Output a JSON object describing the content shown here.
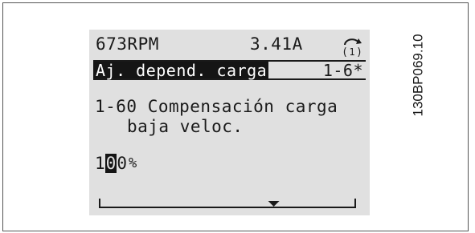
{
  "status": {
    "speed": "673RPM",
    "current": "3.41A",
    "active_setup_icon": "setup-1-icon",
    "active_setup": "1"
  },
  "menu": {
    "title": "Aj. depend. carga",
    "index": "1-6*"
  },
  "parameter": {
    "number_and_name_line1": "1-60 Compensación carga",
    "name_line2": "baja veloc."
  },
  "value": {
    "before_cursor": "1",
    "cursor_digit": "0",
    "after_cursor": "0",
    "unit": "%"
  },
  "bar": {
    "indicator_icon": "triangle-down-icon",
    "level": 0.68
  },
  "figure_id": "130BP069.10",
  "colors": {
    "lcd_background": "#e0e0e0",
    "lcd_text": "#1a1a1a",
    "inverse_background": "#151515"
  }
}
